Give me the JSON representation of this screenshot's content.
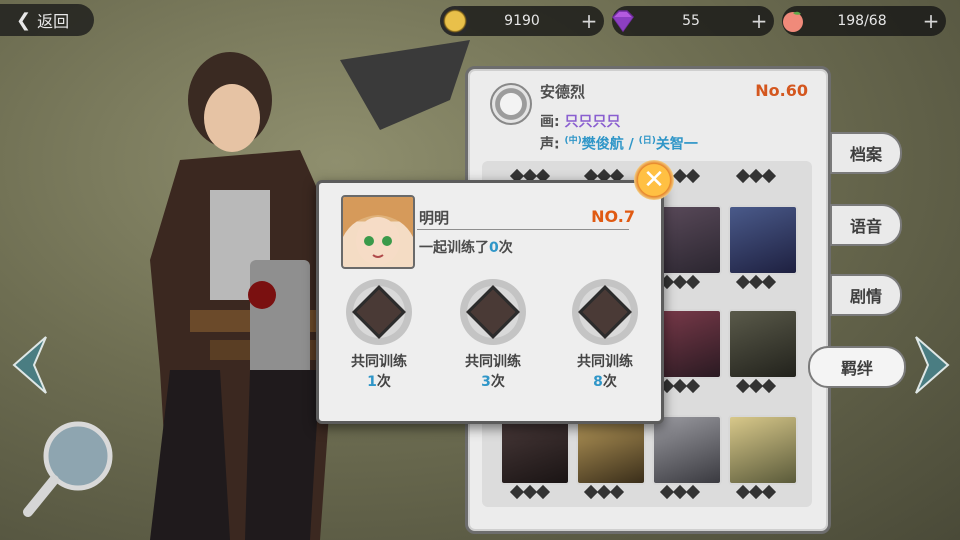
{
  "topbar": {
    "back_label": "返回",
    "gold": "9190",
    "gems": "55",
    "stamina": "198/68",
    "icons": [
      "coin-icon",
      "gem-icon",
      "peach-icon"
    ]
  },
  "character": {
    "name": "安德烈",
    "number": "No.60",
    "painter_label": "画:",
    "painter": "只只只只",
    "voice_label": "声:",
    "cv_cn_tag": "(中)",
    "cv_cn": "樊俊航",
    "separator": "/",
    "cv_jp_tag": "(日)",
    "cv_jp": "关智一"
  },
  "tabs": [
    "档案",
    "语音",
    "剧情",
    "羁绊"
  ],
  "active_tab": "羁绊",
  "popup": {
    "partner_name": "明明",
    "partner_number": "NO.7",
    "trained_prefix": "一起训练了",
    "trained_count": "0",
    "trained_suffix": "次",
    "milestones": [
      {
        "label": "共同训练",
        "count": "1",
        "suffix": "次"
      },
      {
        "label": "共同训练",
        "count": "3",
        "suffix": "次"
      },
      {
        "label": "共同训练",
        "count": "8",
        "suffix": "次"
      }
    ]
  },
  "colors": {
    "accent_orange": "#d4571f",
    "accent_blue": "#2f96c8",
    "accent_purple": "#8a5fd0"
  }
}
